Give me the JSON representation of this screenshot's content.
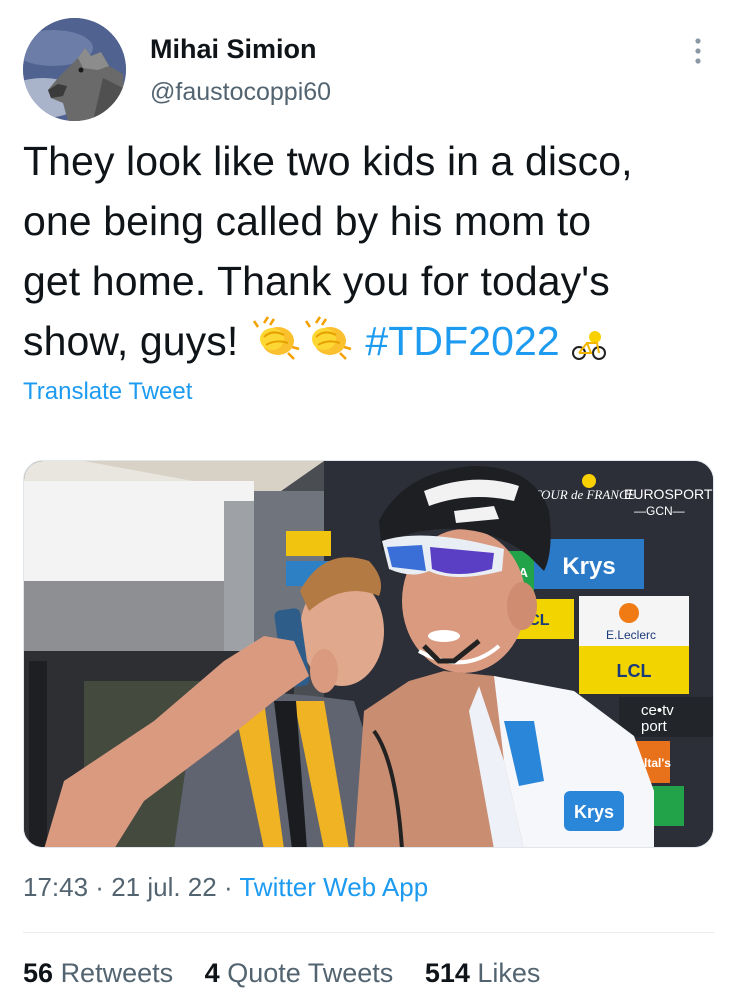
{
  "author": {
    "display_name": "Mihai Simion",
    "handle": "@faustocoppi60",
    "avatar_icon": "wolf-avatar"
  },
  "tweet": {
    "line1": "They look like two kids in a disco,",
    "line2": "one being called by his mom to",
    "line3": "get home. Thank you for today's",
    "line4_text": "show, guys! ",
    "hashtag": "#TDF2022",
    "emojis": [
      "clapping-hands-icon",
      "clapping-hands-icon",
      "tdf-bike-icon"
    ]
  },
  "translate_label": "Translate Tweet",
  "media": {
    "banner_eurosport": "EUROSPORT",
    "banner_gcn": "—GCN—",
    "banner_tour": "TOUR de FRANCE",
    "sponsor_krys": "Krys",
    "sponsor_lcl": "LCL",
    "sponsor_leclerc": "E.Leclerc",
    "sponsor_lcl2": "LCL",
    "sponsor_cetv": "ce•tv",
    "sponsor_port": "port",
    "sponsor_lt": "ltal's",
    "sponsor_a": "ADA",
    "jersey_text": "Krys"
  },
  "meta": {
    "time": "17:43",
    "date": "21 jul. 22",
    "separator": " · ",
    "source": "Twitter Web App"
  },
  "stats": {
    "retweets_count": "56",
    "retweets_label": "Retweets",
    "quotes_count": "4",
    "quotes_label": "Quote Tweets",
    "likes_count": "514",
    "likes_label": "Likes"
  },
  "colors": {
    "link": "#1d9bf0",
    "secondary_text": "#536471",
    "primary_text": "#0f1419"
  }
}
